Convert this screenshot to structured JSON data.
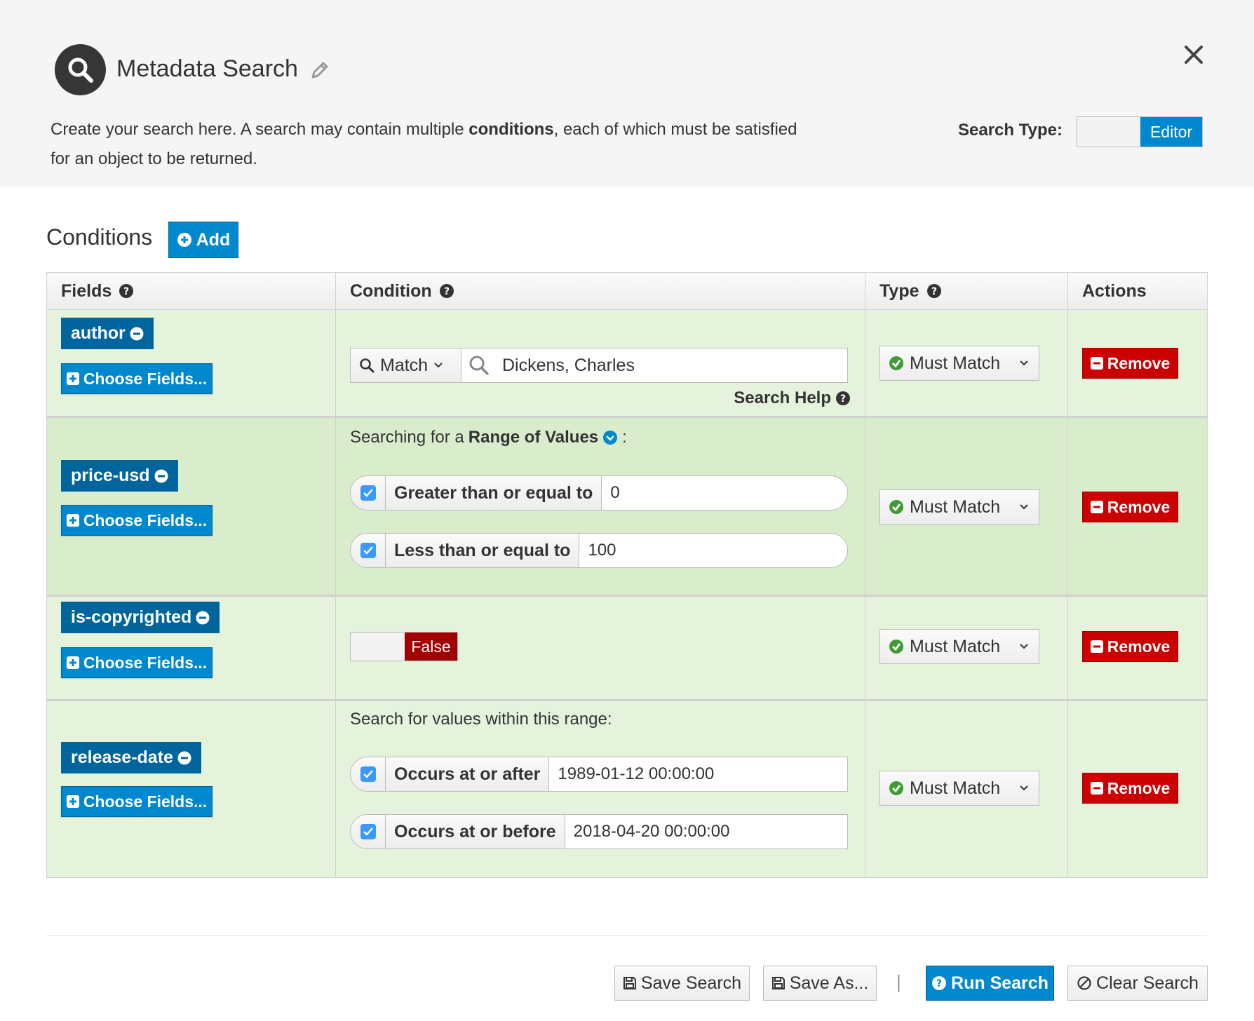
{
  "header": {
    "title": "Metadata Search",
    "description_before": "Create your search here. A search may contain multiple ",
    "description_bold": "conditions",
    "description_after": ", each of which must be satisfied for an object to be returned.",
    "search_type_label": "Search Type:",
    "search_type_value": "Editor"
  },
  "conditions": {
    "title": "Conditions",
    "add_label": "Add",
    "columns": {
      "fields": "Fields",
      "condition": "Condition",
      "type": "Type",
      "actions": "Actions"
    },
    "choose_fields_label": "Choose Fields...",
    "remove_label": "Remove",
    "type_label": "Must Match",
    "rows": [
      {
        "field": "author",
        "match_mode": "Match",
        "value": "Dickens, Charles",
        "search_help": "Search Help"
      },
      {
        "field": "price-usd",
        "caption_before": "Searching for a ",
        "caption_bold": "Range of Values",
        "caption_after": ":",
        "min_label": "Greater than or equal to",
        "min_value": "0",
        "max_label": "Less than or equal to",
        "max_value": "100"
      },
      {
        "field": "is-copyrighted",
        "bool_value": "False"
      },
      {
        "field": "release-date",
        "caption": "Search for values within this range:",
        "after_label": "Occurs at or after",
        "after_value": "1989-01-12 00:00:00",
        "before_label": "Occurs at or before",
        "before_value": "2018-04-20 00:00:00"
      }
    ]
  },
  "footer": {
    "save_search": "Save Search",
    "save_as": "Save As...",
    "separator": "|",
    "run_search": "Run Search",
    "clear_search": "Clear Search"
  },
  "colors": {
    "primary": "#0088ce",
    "field_tag": "#00659c",
    "danger": "#cc0000",
    "row_bg": "#e5f3dd",
    "success": "#3f9c35"
  }
}
